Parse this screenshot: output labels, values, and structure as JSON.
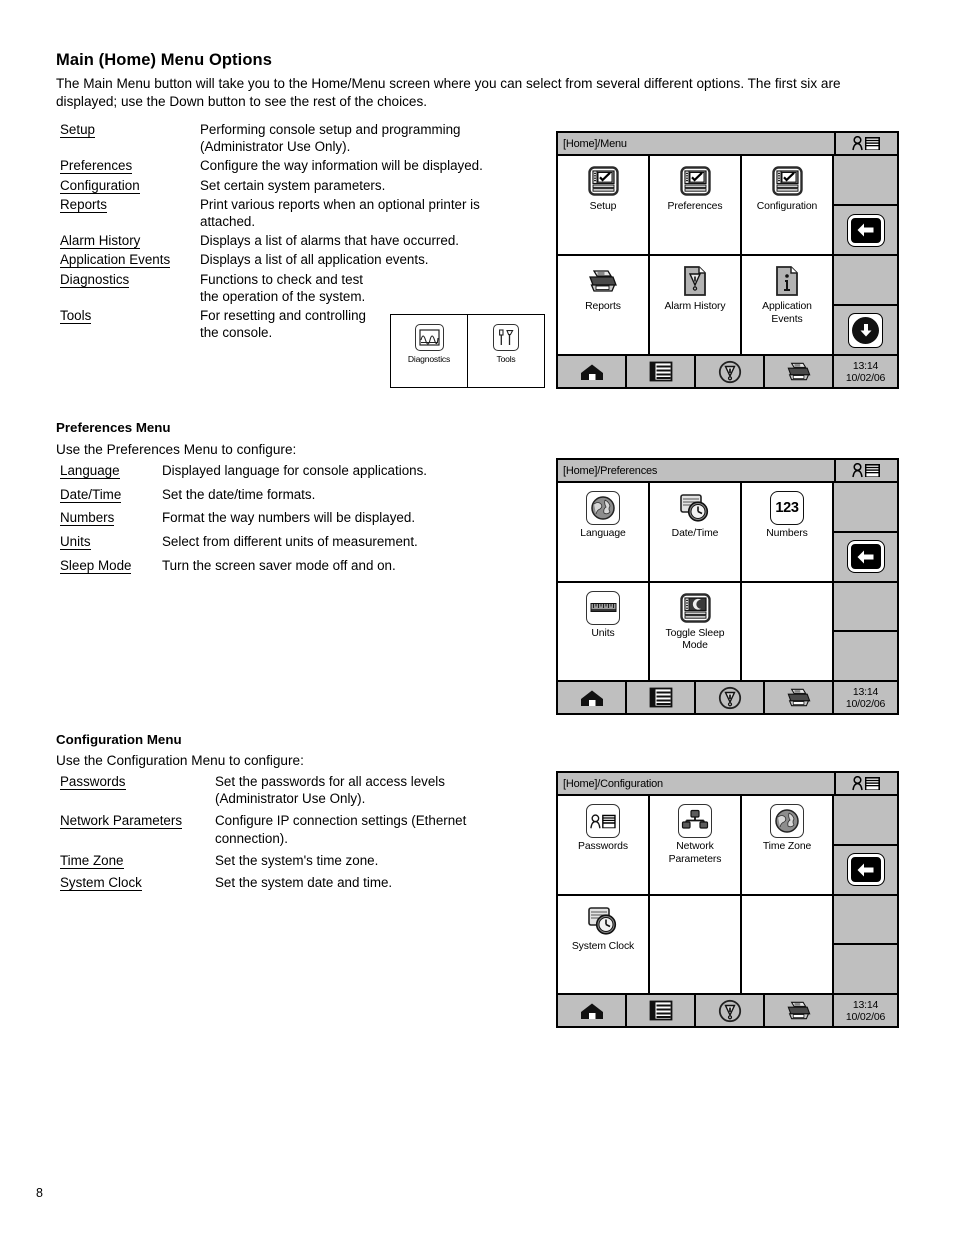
{
  "page": {
    "number": "8"
  },
  "section1": {
    "heading": "Main (Home) Menu Options",
    "intro": "The Main Menu button will take you to the Home/Menu screen where you can select from several different options. The first six are displayed; use the Down button to see the rest of the choices.",
    "items": [
      {
        "term": "Setup",
        "desc": "Performing console setup and programming (Administrator Use Only)."
      },
      {
        "term": "Preferences",
        "desc": "Configure the way information will be displayed."
      },
      {
        "term": "Configuration",
        "desc": "Set certain system parameters."
      },
      {
        "term": "Reports",
        "desc": "Print various reports when an optional printer is attached."
      },
      {
        "term": "Alarm History",
        "desc": "Displays a list of alarms that have occurred."
      },
      {
        "term": "Application Events",
        "desc": "Displays a list of all application events."
      },
      {
        "term": "Diagnostics",
        "desc": "Functions to check and test the operation of the system."
      },
      {
        "term": "Tools",
        "desc": "For resetting and controlling the console."
      }
    ],
    "inset": {
      "cells": [
        {
          "label": "Diagnostics",
          "icon": "waveform-icon"
        },
        {
          "label": "Tools",
          "icon": "tools-icon"
        }
      ]
    }
  },
  "section2": {
    "heading": "Preferences Menu",
    "intro": "Use the Preferences Menu to configure:",
    "items": [
      {
        "term": "Language",
        "desc": "Displayed language for console applications."
      },
      {
        "term": "Date/Time",
        "desc": "Set the date/time formats."
      },
      {
        "term": "Numbers",
        "desc": "Format the way numbers will be displayed."
      },
      {
        "term": "Units",
        "desc": "Select from different units of measurement."
      },
      {
        "term": "Sleep Mode",
        "desc": "Turn the screen saver mode off and on."
      }
    ]
  },
  "section3": {
    "heading": "Configuration Menu",
    "intro": "Use the Configuration Menu to configure:",
    "items": [
      {
        "term": "Passwords",
        "desc": "Set the passwords for all access levels (Administrator Use Only)."
      },
      {
        "term": "Network Parameters",
        "desc": "Configure IP connection settings (Ethernet connection)."
      },
      {
        "term": "Time Zone",
        "desc": "Set the system's time zone."
      },
      {
        "term": "System Clock",
        "desc": "Set the system date and time."
      }
    ]
  },
  "console_menu": {
    "title": "[Home]/Menu",
    "title_icon": "user-login-icon",
    "tiles": [
      {
        "label": "Setup",
        "icon": "checklist-book-icon"
      },
      {
        "label": "Preferences",
        "icon": "checklist-book-icon"
      },
      {
        "label": "Configuration",
        "icon": "checklist-book-icon"
      },
      {
        "label": "Reports",
        "icon": "printer-icon"
      },
      {
        "label": "Alarm History",
        "icon": "alarm-document-icon"
      },
      {
        "label": "Application\nEvents",
        "icon": "info-document-icon"
      }
    ],
    "sidebar": [
      {
        "icon": "back-arrow-icon"
      },
      {
        "icon": "down-arrow-icon"
      }
    ],
    "statusbar": {
      "buttons": [
        {
          "icon": "home-icon"
        },
        {
          "icon": "menu-list-icon"
        },
        {
          "icon": "alarm-bell-icon"
        },
        {
          "icon": "printer-icon"
        }
      ],
      "time": "13:14",
      "date": "10/02/06"
    }
  },
  "console_preferences": {
    "title": "[Home]/Preferences",
    "title_icon": "user-login-icon",
    "tiles": [
      {
        "label": "Language",
        "icon": "globe-icon"
      },
      {
        "label": "Date/Time",
        "icon": "calendar-clock-icon"
      },
      {
        "label": "Numbers",
        "icon": "numbers-123-icon",
        "text": "123"
      },
      {
        "label": "Units",
        "icon": "ruler-icon"
      },
      {
        "label": "Toggle Sleep\nMode",
        "icon": "sleep-monitor-icon"
      },
      {
        "label": "",
        "icon": ""
      }
    ],
    "sidebar": [
      {
        "icon": "back-arrow-icon"
      }
    ],
    "statusbar": {
      "buttons": [
        {
          "icon": "home-icon"
        },
        {
          "icon": "menu-list-icon"
        },
        {
          "icon": "alarm-bell-icon"
        },
        {
          "icon": "printer-icon"
        }
      ],
      "time": "13:14",
      "date": "10/02/06"
    }
  },
  "console_configuration": {
    "title": "[Home]/Configuration",
    "title_icon": "user-login-icon",
    "tiles": [
      {
        "label": "Passwords",
        "icon": "user-password-icon"
      },
      {
        "label": "Network\nParameters",
        "icon": "network-icon"
      },
      {
        "label": "Time Zone",
        "icon": "globe-icon"
      },
      {
        "label": "System Clock",
        "icon": "calendar-clock-icon"
      },
      {
        "label": "",
        "icon": ""
      },
      {
        "label": "",
        "icon": ""
      }
    ],
    "sidebar": [
      {
        "icon": "back-arrow-icon"
      }
    ],
    "statusbar": {
      "buttons": [
        {
          "icon": "home-icon"
        },
        {
          "icon": "menu-list-icon"
        },
        {
          "icon": "alarm-bell-icon"
        },
        {
          "icon": "printer-icon"
        }
      ],
      "time": "13:14",
      "date": "10/02/06"
    }
  },
  "colors": {
    "panel_gray": "#bfbfbf",
    "tile_white": "#ffffff",
    "border_black": "#000000"
  }
}
